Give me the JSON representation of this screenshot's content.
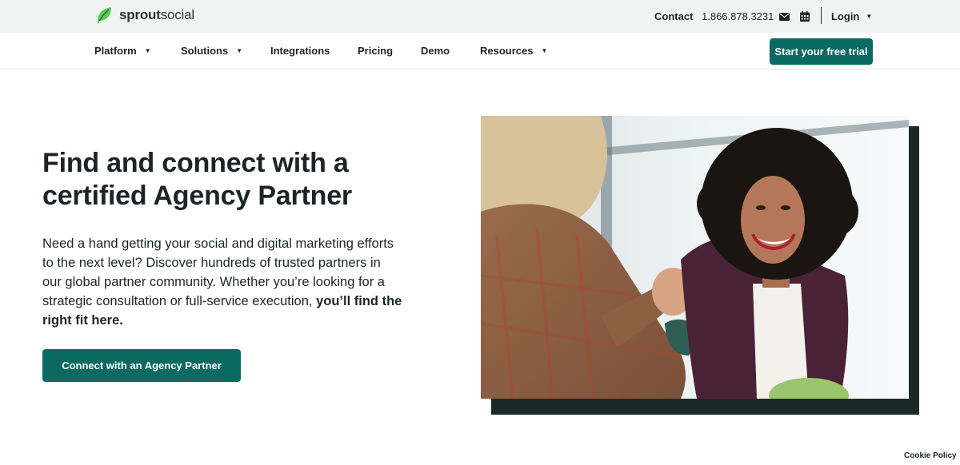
{
  "brand": {
    "name_bold": "sprout",
    "name_regular": "social",
    "logo_icon": "sprout-leaf-icon"
  },
  "utility": {
    "contact_label": "Contact",
    "phone": "1.866.878.3231",
    "mail_icon": "envelope-icon",
    "calendar_icon": "calendar-icon",
    "login_label": "Login"
  },
  "nav": {
    "items": [
      {
        "label": "Platform",
        "has_dropdown": true
      },
      {
        "label": "Solutions",
        "has_dropdown": true
      },
      {
        "label": "Integrations",
        "has_dropdown": false
      },
      {
        "label": "Pricing",
        "has_dropdown": false
      },
      {
        "label": "Demo",
        "has_dropdown": false
      },
      {
        "label": "Resources",
        "has_dropdown": true
      }
    ],
    "cta_label": "Start your free trial"
  },
  "hero": {
    "title": "Find and connect with a certified Agency Partner",
    "body": "Need a hand getting your social and digital marketing efforts to the next level? Discover hundreds of trusted partners in our global partner community. Whether you’re looking for a strategic consultation or full-service execution,",
    "body_bold": "you’ll find the right fit here.",
    "button_label": "Connect with an Agency Partner"
  },
  "footer": {
    "cookie_label": "Cookie Policy"
  },
  "colors": {
    "primary": "#0a6a62",
    "brand_green": "#59cb59",
    "text": "#1b2526",
    "topbar_bg": "#f1f3f2",
    "photo_shadow": "#1c2a27"
  }
}
